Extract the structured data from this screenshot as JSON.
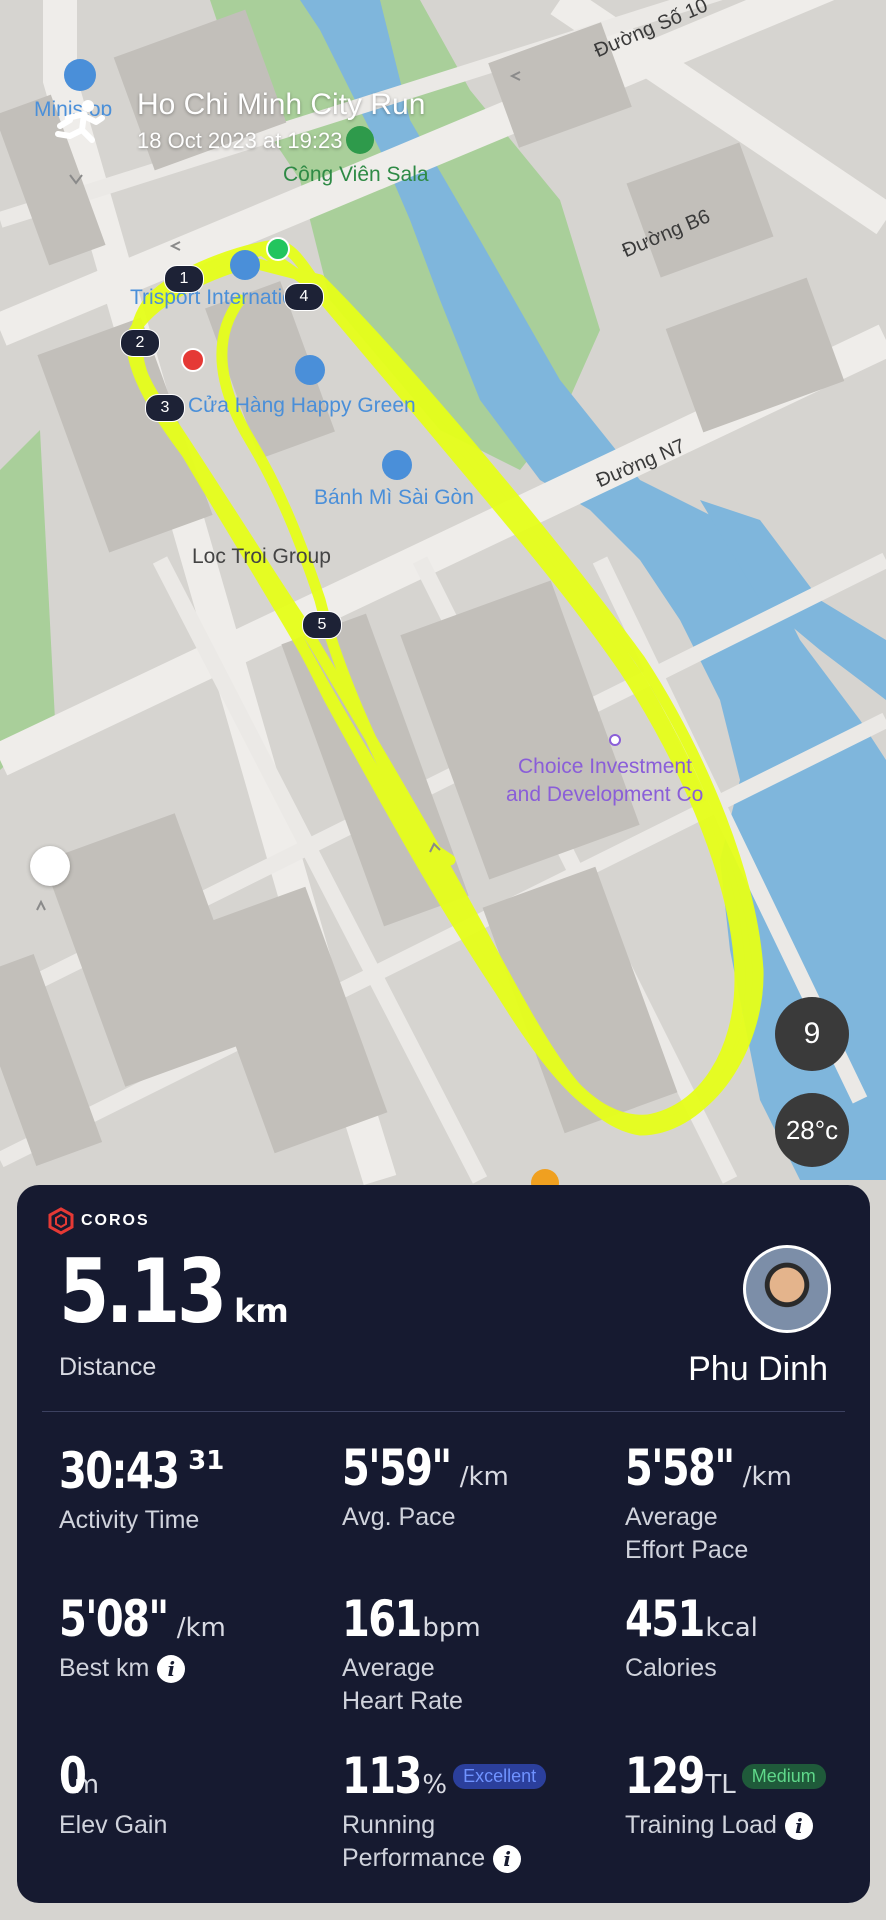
{
  "activity": {
    "title": "Ho Chi Minh City Run",
    "datetime": "18 Oct 2023 at 19:23"
  },
  "map": {
    "pois": {
      "ministop": "Ministop",
      "cong_vien": "Công Viên Sala",
      "trisport": "Trisport International",
      "happy_green": "Cửa Hàng Happy Green",
      "banh_mi": "Bánh Mì Sài Gòn",
      "loc_troi": "Loc Troi Group",
      "choice_1": "Choice Investment",
      "choice_2": "and Development Co"
    },
    "streets": {
      "so": "Đường Số 10",
      "b6": "Đường B6",
      "n7": "Đường N7"
    },
    "laps": [
      "1",
      "2",
      "3",
      "4",
      "5"
    ],
    "compass_value": "9",
    "temperature": "28°c",
    "route_color": "#e6ff1a"
  },
  "card": {
    "brand": "COROS",
    "distance": {
      "value": "5.13",
      "unit": "km",
      "label": "Distance"
    },
    "user": "Phu Dinh",
    "stats": {
      "activity_time": {
        "value": "30:43",
        "sup": "31",
        "label": "Activity Time"
      },
      "avg_pace": {
        "value": "5'59\"",
        "unit": "/km",
        "label": "Avg. Pace"
      },
      "effort_pace": {
        "value": "5'58\"",
        "unit": "/km",
        "label_1": "Average",
        "label_2": "Effort Pace"
      },
      "best_km": {
        "value": "5'08\"",
        "unit": "/km",
        "label": "Best km"
      },
      "heart_rate": {
        "value": "161",
        "unit": "bpm",
        "label_1": "Average",
        "label_2": "Heart Rate"
      },
      "calories": {
        "value": "451",
        "unit": "kcal",
        "label": "Calories"
      },
      "elev_gain": {
        "value": "0",
        "unit": "m",
        "label": "Elev Gain"
      },
      "running_perf": {
        "value": "113",
        "unit": "%",
        "badge": "Excellent",
        "label_1": "Running",
        "label_2": "Performance"
      },
      "training_load": {
        "value": "129",
        "unit": "TL",
        "badge": "Medium",
        "label": "Training Load"
      }
    },
    "colors": {
      "card_bg": "#161a30",
      "excellent_badge": "#2b3f9c",
      "medium_badge": "#1f5a3a",
      "brand_red": "#e53935"
    }
  }
}
